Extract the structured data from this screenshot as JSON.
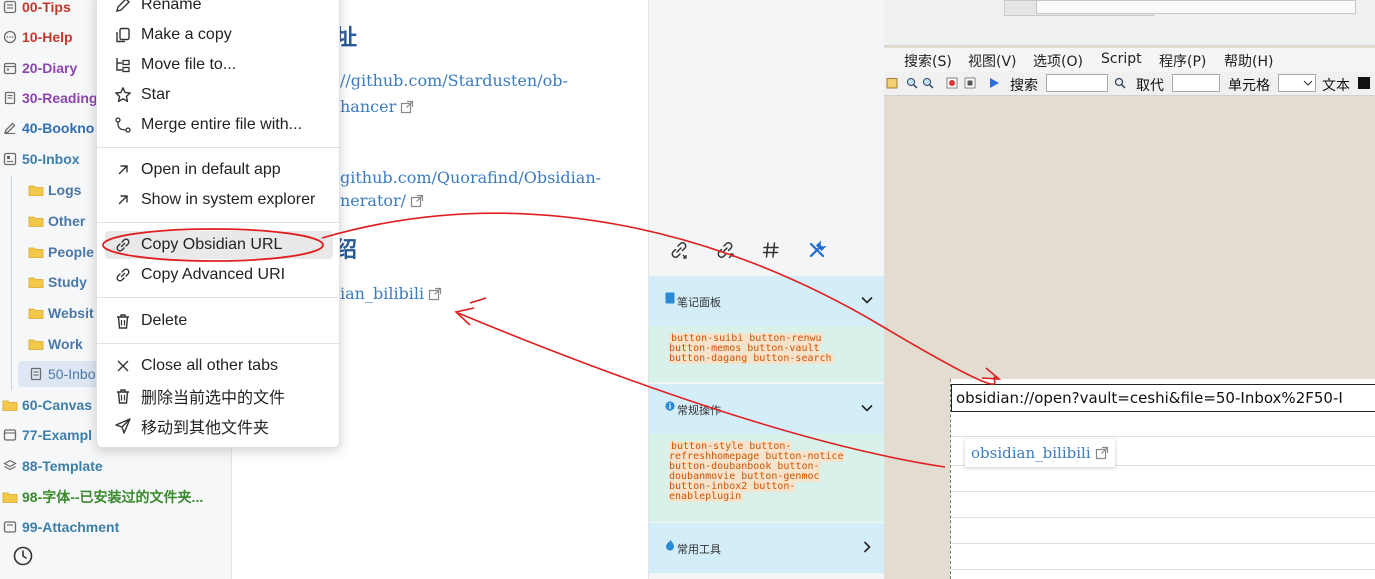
{
  "sidebar": {
    "items": [
      {
        "label": "00-Tips",
        "color": "#c0392b"
      },
      {
        "label": "10-Help",
        "color": "#c0392b"
      },
      {
        "label": "20-Diary",
        "color": "#8e44ad"
      },
      {
        "label": "30-Reading",
        "color": "#8e44ad"
      },
      {
        "label": "40-Bookno",
        "color": "#2f6fb3"
      },
      {
        "label": "50-Inbox",
        "color": "#3d7fa8"
      },
      {
        "label": "Logs",
        "color": "#4a78a8"
      },
      {
        "label": "Other",
        "color": "#4a78a8"
      },
      {
        "label": "People",
        "color": "#4a78a8"
      },
      {
        "label": "Study",
        "color": "#4a78a8"
      },
      {
        "label": "Websit",
        "color": "#4a78a8"
      },
      {
        "label": "Work",
        "color": "#4a78a8"
      },
      {
        "label": "50-Inbo",
        "color": "#4a78a8"
      },
      {
        "label": "60-Canvas",
        "color": "#3d7fa8"
      },
      {
        "label": "77-Exampl",
        "color": "#3d7fa8"
      },
      {
        "label": "88-Template",
        "color": "#3d7fa8"
      },
      {
        "label": "98-字体--已安装过的文件夹...",
        "color": "#3a8a2e"
      },
      {
        "label": "99-Attachment",
        "color": "#3d7fa8"
      }
    ]
  },
  "note": {
    "heading1": "址",
    "link1_line1": "//github.com/Stardusten/ob-",
    "link1_line2": "hancer",
    "link2_line1": "github.com/Quorafind/Obsidian-",
    "link2_line2": "nerator/",
    "heading2": "绍",
    "link3": "ian_bilibili"
  },
  "context_menu": {
    "items": [
      {
        "label": "Rename",
        "icon": "pencil-icon"
      },
      {
        "label": "Make a copy",
        "icon": "copy-icon"
      },
      {
        "label": "Move file to...",
        "icon": "folder-tree-icon"
      },
      {
        "label": "Star",
        "icon": "star-icon"
      },
      {
        "label": "Merge entire file with...",
        "icon": "merge-icon"
      },
      {
        "label": "Open in default app",
        "icon": "arrow-up-right-icon"
      },
      {
        "label": "Show in system explorer",
        "icon": "arrow-up-right-icon"
      },
      {
        "label": "Copy Obsidian URL",
        "icon": "link-icon"
      },
      {
        "label": "Copy Advanced URI",
        "icon": "link-icon"
      },
      {
        "label": "Delete",
        "icon": "trash-icon"
      },
      {
        "label": "Close all other tabs",
        "icon": "close-icon"
      },
      {
        "label": "删除当前选中的文件",
        "icon": "trash-icon"
      },
      {
        "label": "移动到其他文件夹",
        "icon": "send-icon"
      }
    ]
  },
  "panel": {
    "sections": [
      {
        "title": "笔记面板",
        "buttons": "button-suibi button-renwu button-memos button-vault button-dagang button-search"
      },
      {
        "title": "常规操作",
        "buttons": "button-style button-refreshhomepage button-notice button-doubanbook button-doubanmovie button-genmoc button-inbox2 button-enableplugin"
      },
      {
        "title": "常用工具"
      }
    ]
  },
  "editor": {
    "menu": [
      "搜索(S)",
      "视图(V)",
      "选项(O)",
      "Script",
      "程序(P)",
      "帮助(H)"
    ],
    "toolbar": {
      "search_label": "搜索",
      "replace_label": "取代",
      "cell_label": "单元格",
      "text_label": "文本"
    },
    "url_text": "obsidian://open?vault=ceshi&file=50-Inbox%2F50-I",
    "link_text": "obsidian_bilibili"
  },
  "colors": {
    "annotation": "#e02020",
    "accent": "#3b7bbf"
  }
}
